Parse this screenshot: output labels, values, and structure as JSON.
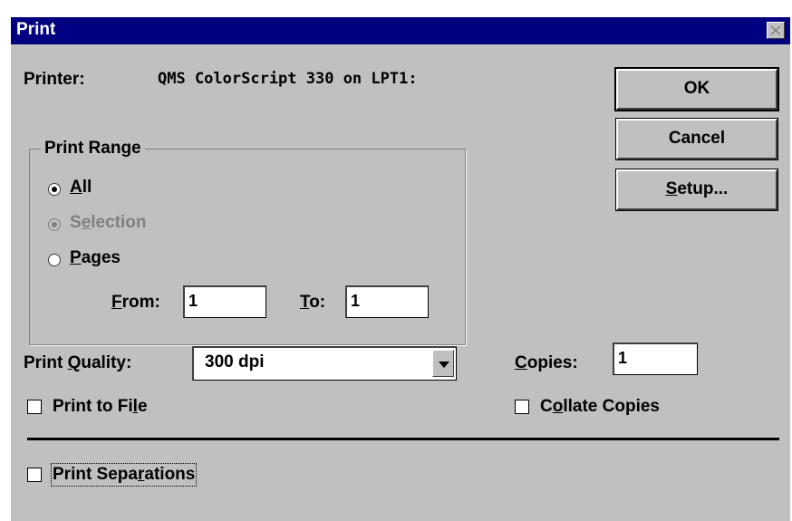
{
  "window": {
    "title": "Print"
  },
  "printer": {
    "label": "Printer:",
    "value": "QMS ColorScript 330 on LPT1:"
  },
  "buttons": {
    "ok": "OK",
    "cancel": "Cancel",
    "setup_pre": "",
    "setup_u": "S",
    "setup_post": "etup..."
  },
  "print_range": {
    "title": "Print Range",
    "all": {
      "u": "A",
      "rest": "ll",
      "selected": true
    },
    "selection": {
      "pre": "S",
      "u": "e",
      "rest": "lection",
      "disabled": true
    },
    "pages": {
      "u": "P",
      "rest": "ages",
      "selected": false
    },
    "from": {
      "u": "F",
      "rest": "rom:",
      "value": "1"
    },
    "to": {
      "u": "T",
      "rest": "o:",
      "value": "1"
    }
  },
  "print_quality": {
    "pre": "Print ",
    "u": "Q",
    "rest": "uality:",
    "value": "300 dpi"
  },
  "copies": {
    "u": "C",
    "rest": "opies:",
    "value": "1"
  },
  "print_to_file": {
    "pre": "Print to Fi",
    "u": "l",
    "rest": "e",
    "checked": false
  },
  "collate_copies": {
    "pre": "C",
    "u": "o",
    "rest": "llate Copies",
    "checked": false
  },
  "print_separations": {
    "pre": "Print Sepa",
    "u": "r",
    "rest": "ations",
    "checked": false
  },
  "colors": {
    "titlebar": "#000080",
    "face": "#c0c0c0",
    "disabled": "#808080"
  }
}
